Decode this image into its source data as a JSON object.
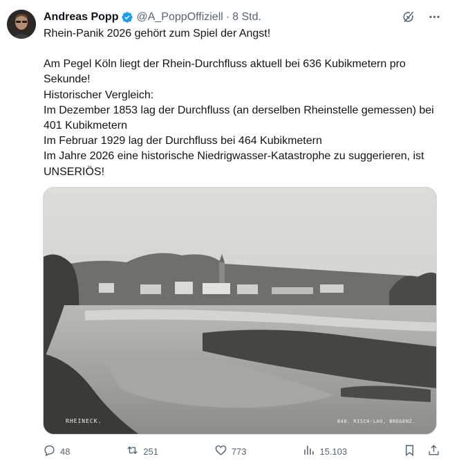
{
  "author": {
    "name": "Andreas Popp",
    "handle": "@A_PoppOffiziell",
    "separator": "·",
    "time": "8 Std."
  },
  "tweet_lines": [
    "Rhein-Panik 2026 gehört zum Spiel der Angst!",
    "Am Pegel Köln liegt der Rhein-Durchfluss aktuell bei 636 Kubikmetern pro Sekunde!",
    "Historischer Vergleich:",
    "Im Dezember 1853 lag der Durchfluss (an derselben Rheinstelle gemessen) bei 401 Kubikmetern",
    "Im Februar 1929 lag der Durchfluss bei 464 Kubikmetern",
    "Im Jahre 2026 eine historische Niedrigwasser-Katastrophe zu suggerieren, ist UNSERIÖS!"
  ],
  "media": {
    "caption_left": "RHEINECK.",
    "caption_right": "848. RISCH-LAU, BREGENZ."
  },
  "actions": {
    "replies": "48",
    "reposts": "251",
    "likes": "773",
    "views": "15.103"
  },
  "icons": {
    "verified": "verified-badge-icon",
    "grok": "grok-icon",
    "more": "more-icon",
    "reply": "reply-icon",
    "repost": "repost-icon",
    "like": "like-icon",
    "views": "views-icon",
    "bookmark": "bookmark-icon",
    "share": "share-icon"
  },
  "colors": {
    "verified": "#1d9bf0",
    "muted": "#536471",
    "text": "#0f1419"
  }
}
